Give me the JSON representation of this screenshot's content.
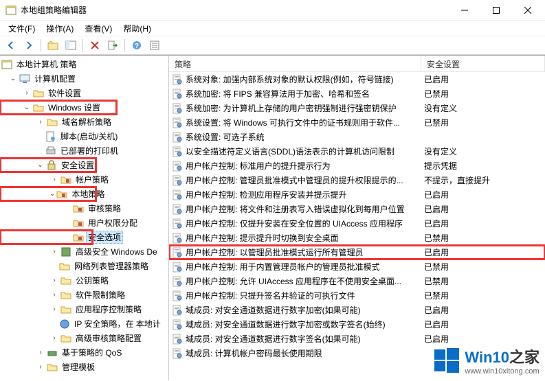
{
  "window": {
    "title": "本地组策略编辑器"
  },
  "menu": {
    "file": "文件(F)",
    "action": "操作(A)",
    "view": "查看(V)",
    "help": "帮助(H)"
  },
  "list": {
    "header_policy": "策略",
    "header_setting": "安全设置"
  },
  "tree": {
    "root": "本地计算机 策略",
    "computer_config": "计算机配置",
    "software_settings": "软件设置",
    "windows_settings": "Windows 设置",
    "dns_policy": "域名解析策略",
    "scripts": "脚本(启动/关机)",
    "deployed_printers": "已部署的打印机",
    "security_settings": "安全设置",
    "account_policy": "帐户策略",
    "local_policy": "本地策略",
    "audit_policy": "审核策略",
    "user_rights": "用户权限分配",
    "security_options": "安全选项",
    "windows_defender": "高级安全 Windows De",
    "network_list": "网络列表管理器策略",
    "public_key": "公钥策略",
    "software_restrict": "软件限制策略",
    "app_control": "应用程序控制策略",
    "ip_security": "IP 安全策略，在 本地计",
    "advanced_audit": "高级审核策略配置",
    "policy_qos": "基于策略的 QoS",
    "admin_templates": "管理模板"
  },
  "rows": [
    {
      "text": "系统对象: 加强内部系统对象的默认权限(例如，符号链接)",
      "setting": "已启用"
    },
    {
      "text": "系统加密: 将 FIPS 兼容算法用于加密、哈希和签名",
      "setting": "已禁用"
    },
    {
      "text": "系统加密: 为计算机上存储的用户密钥强制进行强密钥保护",
      "setting": "没有定义"
    },
    {
      "text": "系统设置: 将 Windows 可执行文件中的证书规则用于软件...",
      "setting": "已禁用"
    },
    {
      "text": "系统设置: 可选子系统",
      "setting": ""
    },
    {
      "text": "以安全描述符定义语言(SDDL)语法表示的计算机访问限制",
      "setting": "没有定义"
    },
    {
      "text": "用户帐户控制: 标准用户的提升提示行为",
      "setting": "提示凭据"
    },
    {
      "text": "用户帐户控制: 管理员批准模式中管理员的提升权限提示的...",
      "setting": "不提示，直接提升"
    },
    {
      "text": "用户帐户控制: 检测应用程序安装并提示提升",
      "setting": "已启用"
    },
    {
      "text": "用户帐户控制: 将文件和注册表写入错误虚拟化到每用户位置",
      "setting": "已启用"
    },
    {
      "text": "用户帐户控制: 仅提升安装在安全位置的 UIAccess 应用程序",
      "setting": "已启用"
    },
    {
      "text": "用户帐户控制: 提示提升时切换到安全桌面",
      "setting": "已禁用"
    },
    {
      "text": "用户帐户控制: 以管理员批准模式运行所有管理员",
      "setting": "已启用",
      "highlight": true
    },
    {
      "text": "用户帐户控制: 用于内置管理员帐户的管理员批准模式",
      "setting": "已禁用"
    },
    {
      "text": "用户帐户控制: 允许 UIAccess 应用程序在不使用安全桌面...",
      "setting": "已禁用"
    },
    {
      "text": "用户帐户控制: 只提升签名并验证的可执行文件",
      "setting": "已禁用"
    },
    {
      "text": "域成员: 对安全通道数据进行数字加密(如果可能)",
      "setting": "已启用"
    },
    {
      "text": "域成员: 对安全通道数据进行数字加密或数字签名(始终)",
      "setting": "已启用"
    },
    {
      "text": "域成员: 对安全通道数据进行数字签名(如果可能)",
      "setting": "已启用"
    },
    {
      "text": "域成员: 计算机帐户密码最长使用期限",
      "setting": ""
    }
  ],
  "watermark": {
    "brand": "Win10",
    "suffix": "之家",
    "url": "www.win10xitong.com"
  }
}
